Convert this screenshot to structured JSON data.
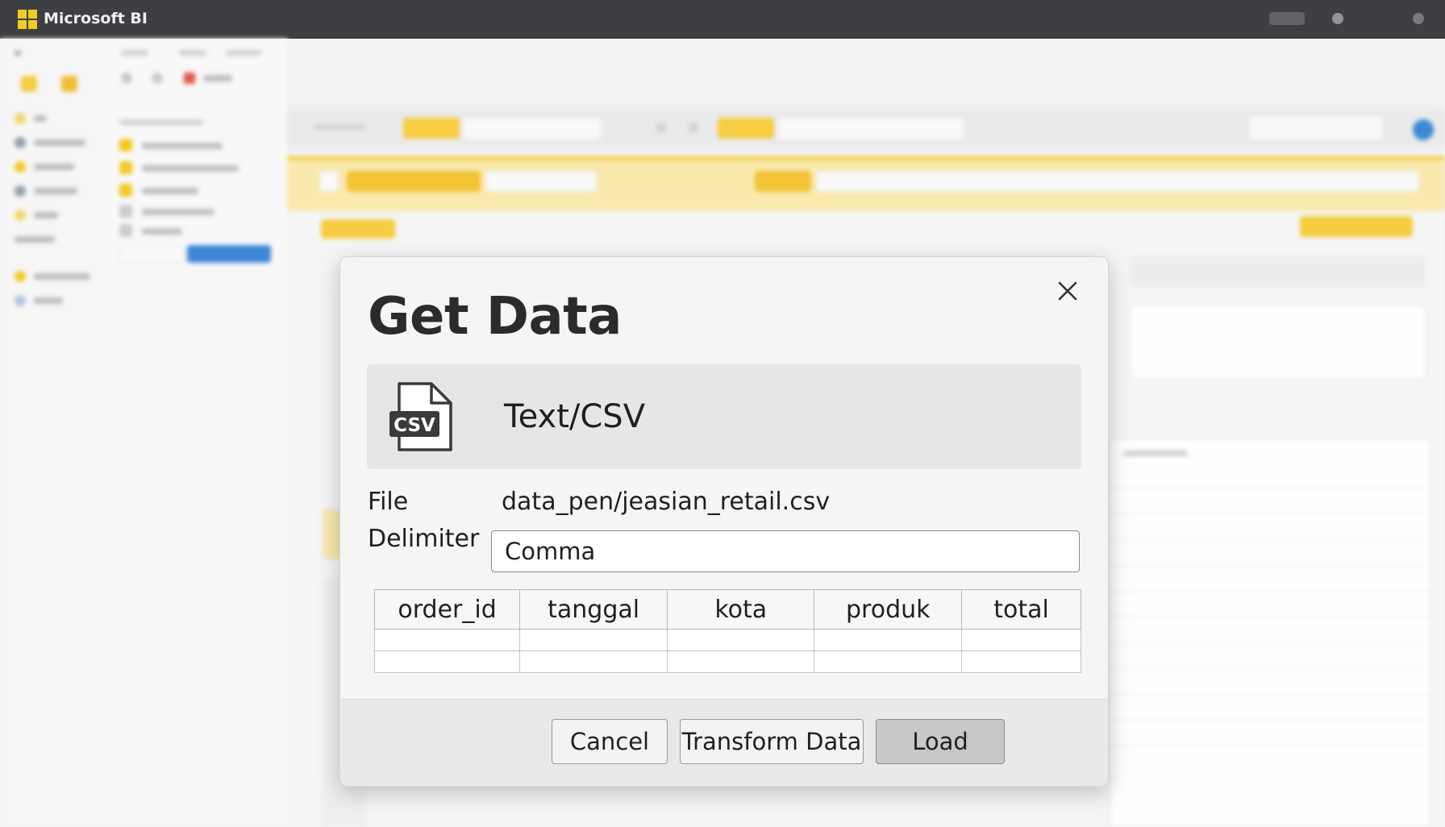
{
  "app": {
    "title": "Microsoft BI"
  },
  "dialog": {
    "title": "Get Data",
    "source": {
      "icon": "csv-file-icon",
      "icon_text": "CSV",
      "name": "Text/CSV"
    },
    "file": {
      "label": "File",
      "value": "data_pen/jeasian_retail.csv"
    },
    "delimiter": {
      "label": "Delimiter",
      "value": "Comma"
    },
    "preview": {
      "columns": [
        "order_id",
        "tanggal",
        "kota",
        "produk",
        "total"
      ],
      "rows": [
        [
          "",
          "",
          "",
          "",
          ""
        ],
        [
          "",
          "",
          "",
          "",
          ""
        ]
      ]
    },
    "buttons": {
      "cancel": "Cancel",
      "transform": "Transform Data",
      "load": "Load"
    }
  },
  "colors": {
    "accent_yellow": "#F2C811",
    "titlebar": "#2F3033",
    "dialog_bg": "#F5F5F5",
    "primary_button": "#C8C8C8"
  }
}
